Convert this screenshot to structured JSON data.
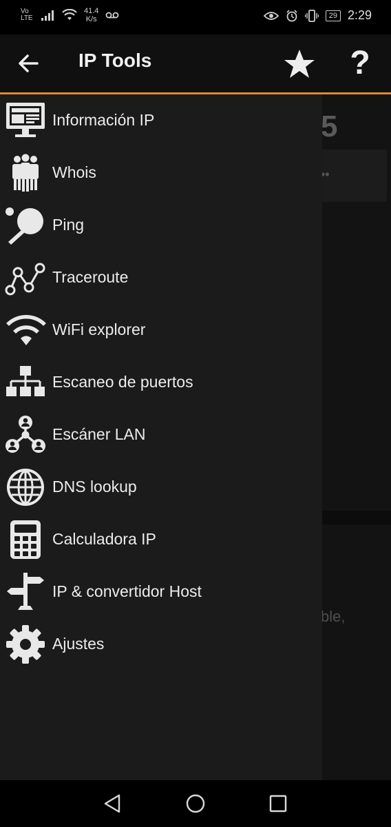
{
  "status_bar": {
    "network_label": "Vo LTE",
    "speed_value": "41.4",
    "speed_unit": "K/s",
    "battery_level": "29",
    "time": "2:29"
  },
  "app_bar": {
    "title": "IP Tools"
  },
  "drawer": {
    "items": [
      {
        "label": "Información IP",
        "icon": "monitor-icon"
      },
      {
        "label": "Whois",
        "icon": "people-icon"
      },
      {
        "label": "Ping",
        "icon": "ping-pong-icon"
      },
      {
        "label": "Traceroute",
        "icon": "traceroute-icon"
      },
      {
        "label": "WiFi explorer",
        "icon": "wifi-icon"
      },
      {
        "label": "Escaneo de puertos",
        "icon": "port-scan-icon"
      },
      {
        "label": "Escáner LAN",
        "icon": "lan-icon"
      },
      {
        "label": "DNS lookup",
        "icon": "globe-icon"
      },
      {
        "label": "Calculadora IP",
        "icon": "calculator-icon"
      },
      {
        "label": "IP & convertidor Host",
        "icon": "signpost-icon"
      },
      {
        "label": "Ajustes",
        "icon": "gear-icon"
      }
    ]
  },
  "background": {
    "digit": "5",
    "dots": "••",
    "text": "ble,"
  },
  "colors": {
    "accent": "#e08b2a",
    "drawer_bg": "#1b1b1b",
    "icon_fill": "#e8e8e8"
  }
}
